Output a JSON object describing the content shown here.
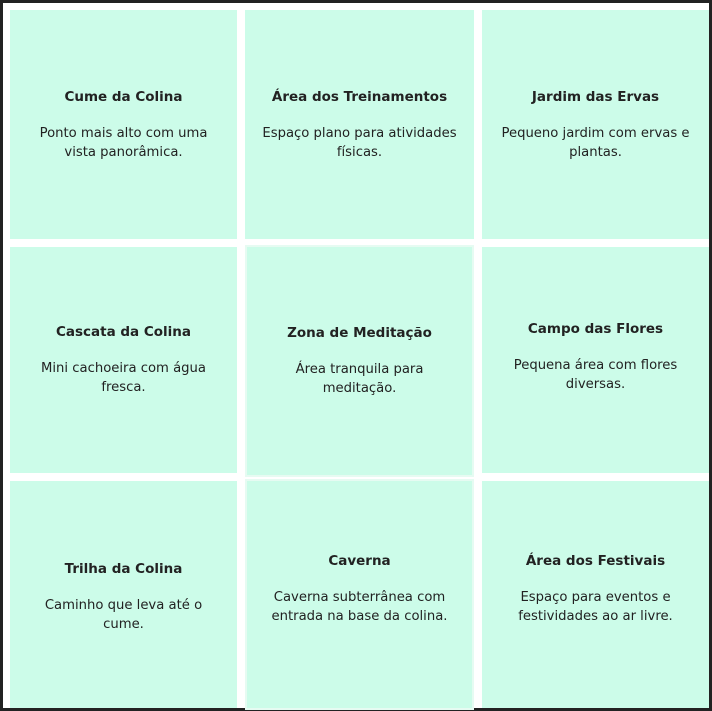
{
  "grid": {
    "tiles": [
      {
        "title": "Cume da Colina",
        "description": "Ponto mais alto com uma vista panorâmica."
      },
      {
        "title": "Área dos Treinamentos",
        "description": "Espaço plano para atividades físicas."
      },
      {
        "title": "Jardim das Ervas",
        "description": "Pequeno jardim com ervas e plantas."
      },
      {
        "title": "Cascata da Colina",
        "description": "Mini cachoeira com água fresca."
      },
      {
        "title": "Zona de Meditação",
        "description": "Área tranquila para meditação."
      },
      {
        "title": "Campo das Flores",
        "description": "Pequena área com flores diversas."
      },
      {
        "title": "Trilha da Colina",
        "description": "Caminho que leva até o cume."
      },
      {
        "title": "Caverna",
        "description": "Caverna subterrânea com entrada na base da colina."
      },
      {
        "title": "Área dos Festivais",
        "description": "Espaço para eventos e festividades ao ar livre."
      }
    ]
  },
  "colors": {
    "tile_background": "#ccfce9",
    "border": "#222222",
    "text": "#222222"
  }
}
